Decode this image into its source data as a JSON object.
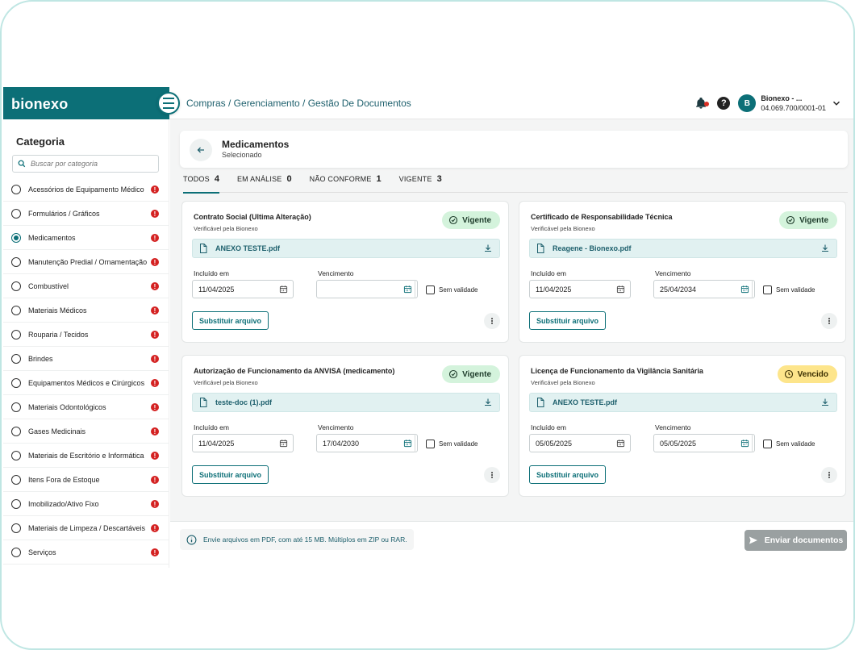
{
  "brand": {
    "name": "bionexo"
  },
  "header": {
    "breadcrumb": "Compras / Gerenciamento / Gestão De Documentos",
    "account_name": "Bionexo - ...",
    "account_cnpj": "04.069.700/0001-01",
    "avatar_initial": "B"
  },
  "sidebar": {
    "title": "Categoria",
    "search_placeholder": "Buscar por categoria",
    "items": [
      {
        "label": "Acessórios de Equipamento Médico",
        "selected": false
      },
      {
        "label": "Formulários / Gráficos",
        "selected": false
      },
      {
        "label": "Medicamentos",
        "selected": true
      },
      {
        "label": "Manutenção Predial / Ornamentação",
        "selected": false
      },
      {
        "label": "Combustível",
        "selected": false
      },
      {
        "label": "Materiais Médicos",
        "selected": false
      },
      {
        "label": "Rouparia / Tecidos",
        "selected": false
      },
      {
        "label": "Brindes",
        "selected": false
      },
      {
        "label": "Equipamentos Médicos e Cirúrgicos",
        "selected": false
      },
      {
        "label": "Materiais Odontológicos",
        "selected": false
      },
      {
        "label": "Gases Medicinais",
        "selected": false
      },
      {
        "label": "Materiais de Escritório e Informática",
        "selected": false
      },
      {
        "label": "Itens Fora de Estoque",
        "selected": false
      },
      {
        "label": "Imobilizado/Ativo Fixo",
        "selected": false
      },
      {
        "label": "Materiais de Limpeza / Descartáveis",
        "selected": false
      },
      {
        "label": "Serviços",
        "selected": false
      }
    ]
  },
  "main": {
    "title": "Medicamentos",
    "subtitle": "Selecionado",
    "tabs": [
      {
        "label": "TODOS",
        "count": "4",
        "active": true
      },
      {
        "label": "EM ANÁLISE",
        "count": "0",
        "active": false
      },
      {
        "label": "NÃO CONFORME",
        "count": "1",
        "active": false
      },
      {
        "label": "VIGENTE",
        "count": "3",
        "active": false
      }
    ],
    "field_labels": {
      "included": "Incluído em",
      "due": "Vencimento",
      "no_validity": "Sem validade",
      "replace": "Substituir arquivo"
    },
    "documents": [
      {
        "title": "Contrato Social (Ultima Alteração)",
        "subtitle": "Verificável pela Bionexo",
        "status": "Vigente",
        "status_color": "#d4f3dc",
        "file": "ANEXO TESTE.pdf",
        "included": "11/04/2025",
        "due": ""
      },
      {
        "title": "Certificado de Responsabilidade Técnica",
        "subtitle": "Verificável pela Bionexo",
        "status": "Vigente",
        "status_color": "#d4f3dc",
        "file": "Reagene - Bionexo.pdf",
        "included": "11/04/2025",
        "due": "25/04/2034"
      },
      {
        "title": "Autorização de Funcionamento da ANVISA (medicamento)",
        "subtitle": "Verificável pela Bionexo",
        "status": "Vigente",
        "status_color": "#d4f3dc",
        "file": "teste-doc (1).pdf",
        "included": "11/04/2025",
        "due": "17/04/2030"
      },
      {
        "title": "Licença de Funcionamento da Vigilância Sanitária",
        "subtitle": "Verificável pela Bionexo",
        "status": "Vencido",
        "status_color": "#fde58b",
        "file": "ANEXO TESTE.pdf",
        "included": "05/05/2025",
        "due": "05/05/2025"
      }
    ]
  },
  "footer": {
    "info": "Envie arquivos em PDF, com até 15 MB. Múltiplos em ZIP ou RAR.",
    "send_label": "Enviar documentos"
  },
  "colors": {
    "brand": "#0c6f77",
    "alert": "#d42222",
    "disabled": "#9aa0a1"
  }
}
